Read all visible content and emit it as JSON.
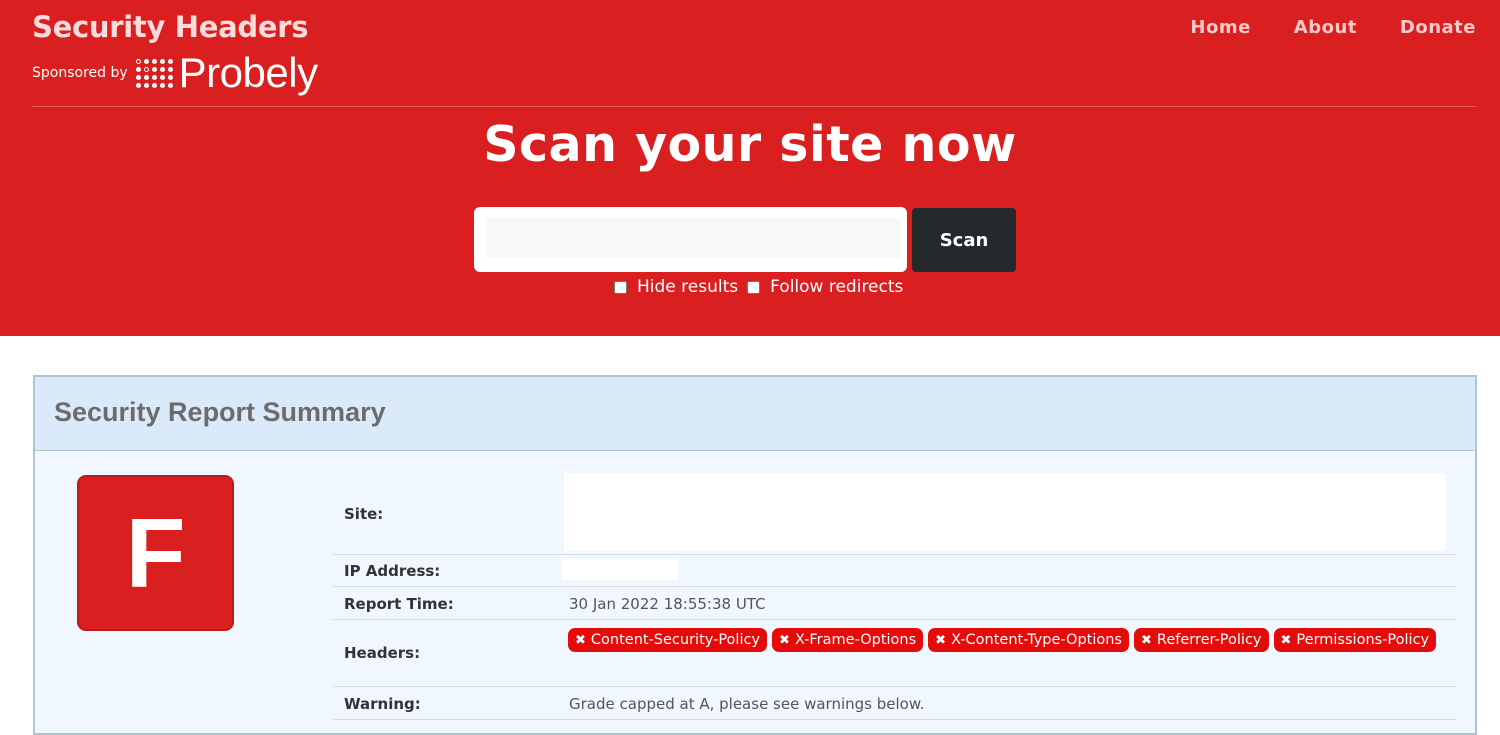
{
  "header": {
    "brand_title": "Security Headers",
    "sponsored_by": "Sponsored by",
    "sponsor_name": "Probely",
    "nav": [
      {
        "label": "Home"
      },
      {
        "label": "About"
      },
      {
        "label": "Donate"
      }
    ]
  },
  "hero": {
    "title": "Scan your site now",
    "search": {
      "value": "",
      "placeholder": ""
    },
    "scan_label": "Scan",
    "options": [
      {
        "label": "Hide results",
        "checked": false
      },
      {
        "label": "Follow redirects",
        "checked": false
      }
    ]
  },
  "report": {
    "title": "Security Report Summary",
    "grade": "F",
    "rows": {
      "site": {
        "label": "Site:",
        "value": ""
      },
      "ip": {
        "label": "IP Address:",
        "value": ""
      },
      "time": {
        "label": "Report Time:",
        "value": "30 Jan 2022 18:55:38 UTC"
      },
      "headers": {
        "label": "Headers:",
        "items": [
          "Content-Security-Policy",
          "X-Frame-Options",
          "X-Content-Type-Options",
          "Referrer-Policy",
          "Permissions-Policy"
        ]
      },
      "warning": {
        "label": "Warning:",
        "value": "Grade capped at A, please see warnings below."
      }
    }
  },
  "colors": {
    "brand_red": "#da1f20",
    "badge_red": "#e40b0b",
    "scan_button": "#26292c",
    "panel_bg": "#f0f7ff",
    "panel_header_bg": "#dbeafa"
  },
  "icons": {
    "missing_header": "close-icon",
    "sponsor_logo": "probely-dots-icon"
  }
}
